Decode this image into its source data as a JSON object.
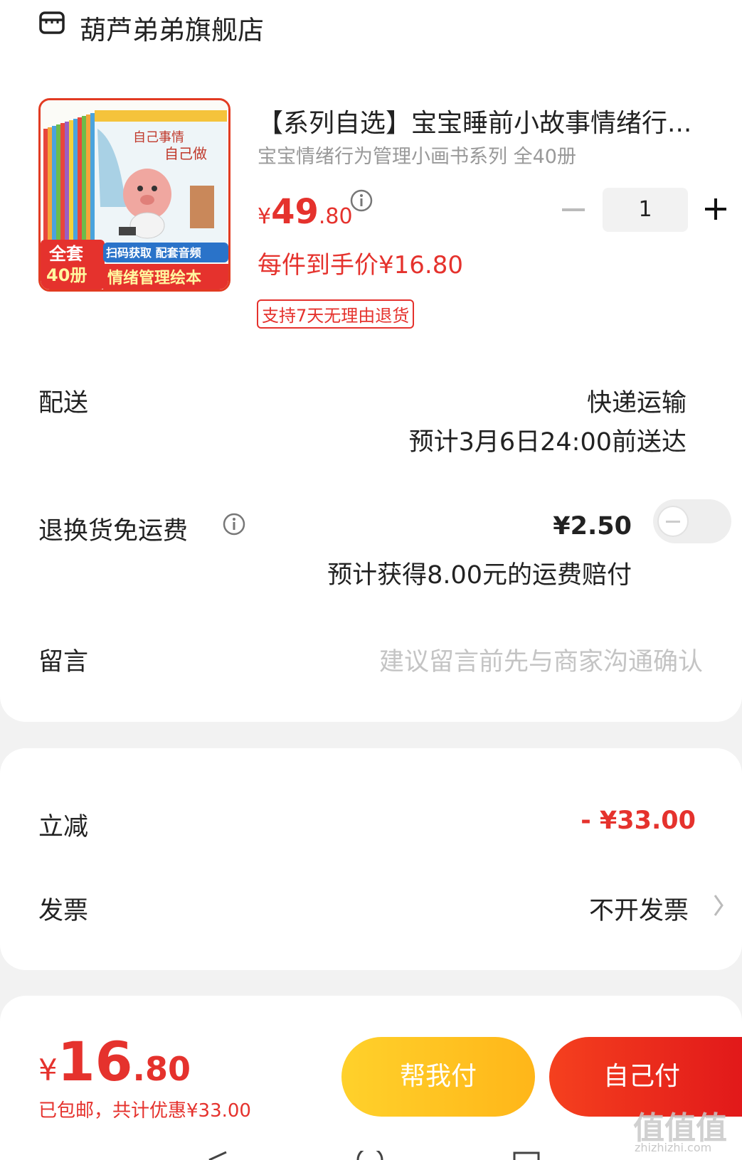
{
  "shop": {
    "name": "葫芦弟弟旗舰店",
    "icon": "store-icon"
  },
  "product": {
    "title": "【系列自选】宝宝睡前小故事情绪行...",
    "subtitle": "宝宝情绪行为管理小画书系列 全40册",
    "price_yen": "¥",
    "price_int": "49",
    "price_dec": ".80",
    "unit_price": "每件到手价¥16.80",
    "return_tag": "支持7天无理由退货",
    "quantity": "1",
    "image": {
      "book_title_1": "自己事情",
      "book_title_2": "自己做",
      "badge_1": "全套",
      "badge_2": "40册",
      "banner_1": "扫码获取 配套音频",
      "banner_2": "情绪管理绘本"
    }
  },
  "delivery": {
    "label": "配送",
    "method": "快递运输",
    "eta": "预计3月6日24:00前送达"
  },
  "return_shipping": {
    "label": "退换货免运费",
    "price": "¥2.50",
    "note": "预计获得8.00元的运费赔付",
    "enabled": false
  },
  "message": {
    "label": "留言",
    "placeholder": "建议留言前先与商家沟通确认"
  },
  "discount": {
    "label": "立减",
    "value": "- ¥33.00"
  },
  "invoice": {
    "label": "发票",
    "value": "不开发票"
  },
  "bottom": {
    "total_yen": "¥",
    "total_int": "16",
    "total_dec": ".80",
    "note": "已包邮，共计优惠¥33.00",
    "help_pay": "帮我付",
    "self_pay": "自己付"
  },
  "watermark": {
    "main": "值值值",
    "sub": "zhizhizhi.com"
  },
  "colors": {
    "accent": "#e5322d",
    "help_button": "#ffc21f",
    "pay_button": "#ea2a1c"
  }
}
